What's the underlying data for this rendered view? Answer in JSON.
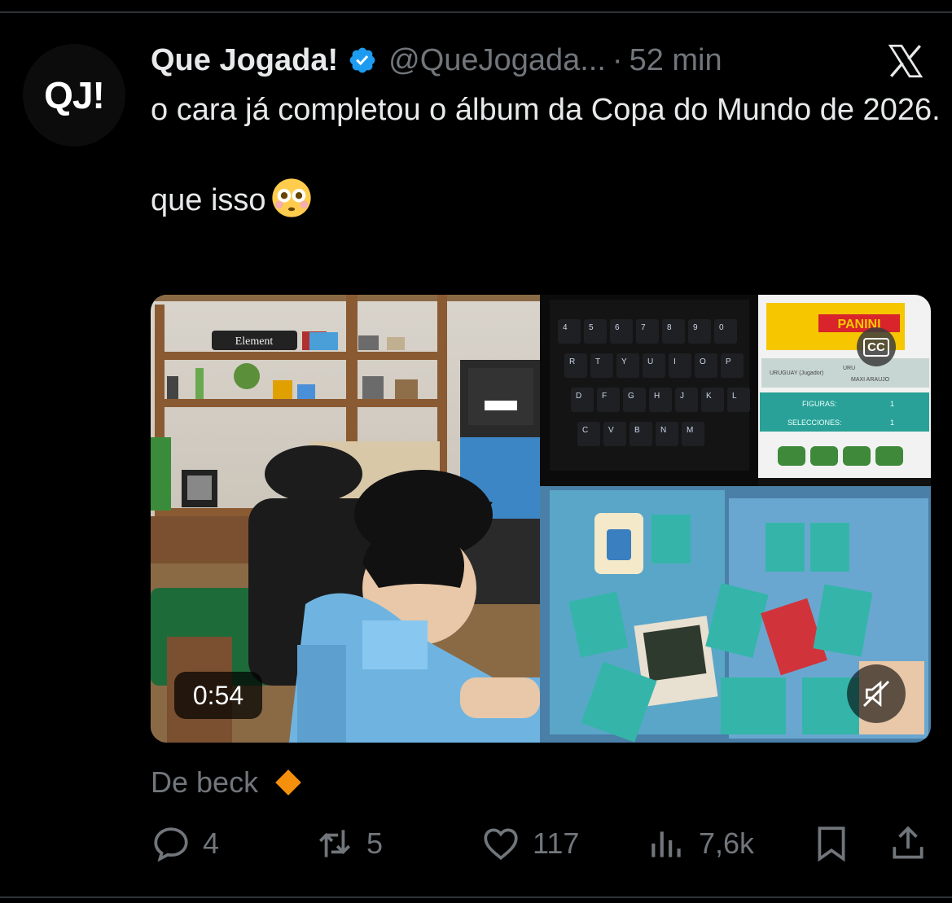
{
  "tweet": {
    "avatar_text": "QJ!",
    "author_name": "Que Jogada!",
    "handle": "@QueJogada...",
    "separator": "·",
    "time": "52 min",
    "text_line1": "o cara já completou o álbum da Copa do Mundo de 2026.",
    "text_line2": "que isso",
    "emoji": "flushed-face"
  },
  "media": {
    "duration": "0:54",
    "cc_label": "CC",
    "left_scene": {
      "shelf_sign": "Element"
    },
    "right_scene": {
      "brand": "PANINI",
      "label_country": "URUGUAY (Jugador)",
      "label_player": "MAXI ARAUJO",
      "label_code": "URU",
      "row1_label": "FIGURAS:",
      "row1_value": "1",
      "row2_label": "SELECCIONES:",
      "row2_value": "1",
      "keys_row1": [
        "4",
        "5",
        "6",
        "7",
        "8",
        "9",
        "0"
      ],
      "keys_row2": [
        "R",
        "T",
        "Y",
        "U",
        "I",
        "O",
        "P"
      ],
      "keys_row3": [
        "D",
        "F",
        "G",
        "H",
        "J",
        "K",
        "L"
      ],
      "keys_row4": [
        "C",
        "V",
        "B",
        "N",
        "M"
      ]
    }
  },
  "source": {
    "label": "De beck"
  },
  "actions": {
    "replies": "4",
    "reposts": "5",
    "likes": "117",
    "views": "7,6k"
  },
  "colors": {
    "background": "#000000",
    "text_primary": "#e7e9ea",
    "text_secondary": "#71767b",
    "verified": "#1d9bf0",
    "divider": "#2f3336"
  }
}
